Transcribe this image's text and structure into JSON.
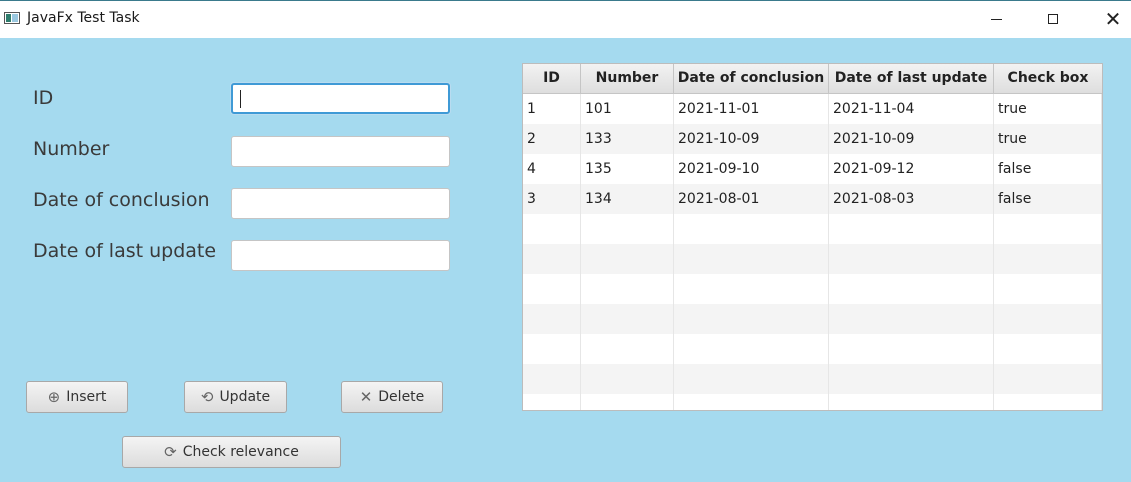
{
  "window": {
    "title": "JavaFx Test Task",
    "minimize_icon": "minimize-icon",
    "maximize_icon": "maximize-icon",
    "close_icon": "close-icon"
  },
  "form": {
    "fields": [
      {
        "label": "ID",
        "value": "",
        "focused": true
      },
      {
        "label": "Number",
        "value": ""
      },
      {
        "label": "Date of conclusion",
        "value": ""
      },
      {
        "label": "Date of last update",
        "value": ""
      }
    ]
  },
  "buttons": {
    "insert": {
      "label": "Insert",
      "icon": "plus-circle-icon"
    },
    "update": {
      "label": "Update",
      "icon": "update-icon"
    },
    "delete": {
      "label": "Delete",
      "icon": "x-icon"
    },
    "check_relevance": {
      "label": "Check relevance",
      "icon": "refresh-icon"
    }
  },
  "table": {
    "columns": [
      "ID",
      "Number",
      "Date of conclusion",
      "Date of last update",
      "Check box"
    ],
    "rows": [
      [
        "1",
        "101",
        "2021-11-01",
        "2021-11-04",
        "true"
      ],
      [
        "2",
        "133",
        "2021-10-09",
        "2021-10-09",
        "true"
      ],
      [
        "4",
        "135",
        "2021-09-10",
        "2021-09-12",
        "false"
      ],
      [
        "3",
        "134",
        "2021-08-01",
        "2021-08-03",
        "false"
      ]
    ]
  },
  "colors": {
    "background": "#a5daef",
    "focus_border": "#3f9ad6"
  }
}
